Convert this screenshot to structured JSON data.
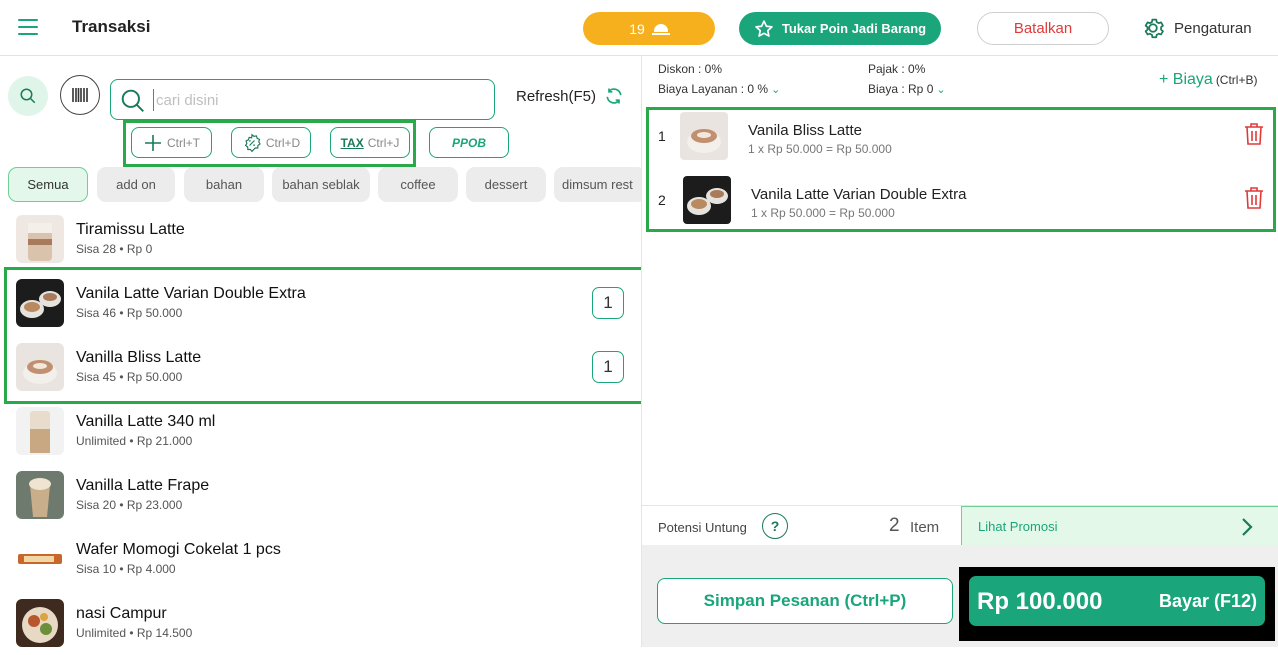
{
  "header": {
    "title": "Transaksi",
    "queue_count": "19",
    "poin_label": "Tukar Poin Jadi Barang",
    "cancel_label": "Batalkan",
    "settings_label": "Pengaturan"
  },
  "search": {
    "placeholder": "cari disini",
    "refresh_label": "Refresh(F5)"
  },
  "shortcuts": {
    "add": "Ctrl+T",
    "discount": "Ctrl+D",
    "tax_mark": "TAX",
    "tax": "Ctrl+J",
    "ppob": "PPOB"
  },
  "categories": [
    {
      "label": "Semua",
      "active": true
    },
    {
      "label": "add on"
    },
    {
      "label": "bahan"
    },
    {
      "label": "bahan seblak"
    },
    {
      "label": "coffee"
    },
    {
      "label": "dessert"
    },
    {
      "label": "dimsum rest"
    }
  ],
  "products": [
    {
      "name": "Tiramissu Latte",
      "sub": "Sisa 28 • Rp 0",
      "qty": ""
    },
    {
      "name": "Vanila Latte Varian Double Extra",
      "sub": "Sisa 46 • Rp 50.000",
      "qty": "1"
    },
    {
      "name": "Vanilla Bliss Latte",
      "sub": "Sisa 45 • Rp 50.000",
      "qty": "1"
    },
    {
      "name": "Vanilla Latte 340 ml",
      "sub": "Unlimited • Rp 21.000",
      "qty": ""
    },
    {
      "name": "Vanilla Latte Frape",
      "sub": "Sisa 20 • Rp 23.000",
      "qty": ""
    },
    {
      "name": "Wafer Momogi Cokelat  1 pcs",
      "sub": "Sisa 10 • Rp 4.000",
      "qty": ""
    },
    {
      "name": "nasi Campur",
      "sub": "Unlimited • Rp 14.500",
      "qty": ""
    }
  ],
  "summary": {
    "diskon": "Diskon : 0%",
    "biaya_layanan": "Biaya Layanan : 0 %",
    "pajak": "Pajak : 0%",
    "biaya_pajak": "Biaya : Rp 0",
    "biaya_add": "+ Biaya",
    "biaya_shortcut": "(Ctrl+B)"
  },
  "cart": [
    {
      "no": "1",
      "name": "Vanila Bliss Latte",
      "detail": "1 x Rp 50.000 = Rp 50.000"
    },
    {
      "no": "2",
      "name": "Vanila Latte Varian Double Extra",
      "detail": "1 x Rp 50.000 = Rp 50.000"
    }
  ],
  "footer": {
    "potensi_label": "Potensi Untung",
    "help": "?",
    "item_count": "2",
    "item_label": "Item",
    "promo_label": "Lihat Promosi",
    "save_label": "Simpan Pesanan (Ctrl+P)",
    "total": "Rp 100.000",
    "pay_label": "Bayar (F12)"
  },
  "colors": {
    "accent": "#1aa57a",
    "highlight_frame": "#2aa84a",
    "queue": "#f6b01e",
    "danger": "#e03a3a"
  }
}
